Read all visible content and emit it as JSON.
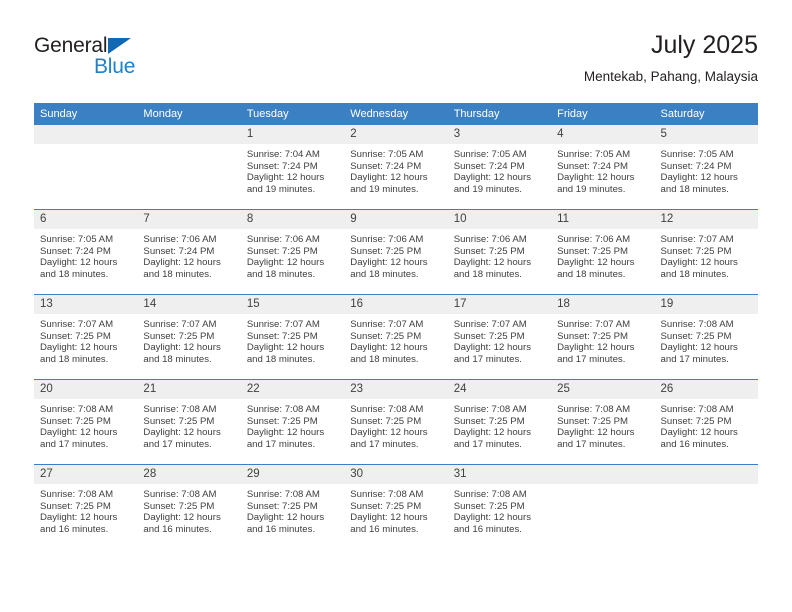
{
  "brand": {
    "name_top": "General",
    "name_bottom": "Blue",
    "color_dark": "#231f20",
    "color_blue": "#1b82d2",
    "triangle_color": "#1368b4"
  },
  "header": {
    "title": "July 2025",
    "subtitle": "Mentekab, Pahang, Malaysia"
  },
  "theme": {
    "header_bg": "#3c80c4",
    "date_band_bg": "#efefef",
    "text": "#404040"
  },
  "weekday_headers": [
    "Sunday",
    "Monday",
    "Tuesday",
    "Wednesday",
    "Thursday",
    "Friday",
    "Saturday"
  ],
  "weeks": [
    [
      {
        "date": "",
        "sunrise": "",
        "sunset": "",
        "daylight": ""
      },
      {
        "date": "",
        "sunrise": "",
        "sunset": "",
        "daylight": ""
      },
      {
        "date": "1",
        "sunrise": "Sunrise: 7:04 AM",
        "sunset": "Sunset: 7:24 PM",
        "daylight": "Daylight: 12 hours and 19 minutes."
      },
      {
        "date": "2",
        "sunrise": "Sunrise: 7:05 AM",
        "sunset": "Sunset: 7:24 PM",
        "daylight": "Daylight: 12 hours and 19 minutes."
      },
      {
        "date": "3",
        "sunrise": "Sunrise: 7:05 AM",
        "sunset": "Sunset: 7:24 PM",
        "daylight": "Daylight: 12 hours and 19 minutes."
      },
      {
        "date": "4",
        "sunrise": "Sunrise: 7:05 AM",
        "sunset": "Sunset: 7:24 PM",
        "daylight": "Daylight: 12 hours and 19 minutes."
      },
      {
        "date": "5",
        "sunrise": "Sunrise: 7:05 AM",
        "sunset": "Sunset: 7:24 PM",
        "daylight": "Daylight: 12 hours and 18 minutes."
      }
    ],
    [
      {
        "date": "6",
        "sunrise": "Sunrise: 7:05 AM",
        "sunset": "Sunset: 7:24 PM",
        "daylight": "Daylight: 12 hours and 18 minutes."
      },
      {
        "date": "7",
        "sunrise": "Sunrise: 7:06 AM",
        "sunset": "Sunset: 7:24 PM",
        "daylight": "Daylight: 12 hours and 18 minutes."
      },
      {
        "date": "8",
        "sunrise": "Sunrise: 7:06 AM",
        "sunset": "Sunset: 7:25 PM",
        "daylight": "Daylight: 12 hours and 18 minutes."
      },
      {
        "date": "9",
        "sunrise": "Sunrise: 7:06 AM",
        "sunset": "Sunset: 7:25 PM",
        "daylight": "Daylight: 12 hours and 18 minutes."
      },
      {
        "date": "10",
        "sunrise": "Sunrise: 7:06 AM",
        "sunset": "Sunset: 7:25 PM",
        "daylight": "Daylight: 12 hours and 18 minutes."
      },
      {
        "date": "11",
        "sunrise": "Sunrise: 7:06 AM",
        "sunset": "Sunset: 7:25 PM",
        "daylight": "Daylight: 12 hours and 18 minutes."
      },
      {
        "date": "12",
        "sunrise": "Sunrise: 7:07 AM",
        "sunset": "Sunset: 7:25 PM",
        "daylight": "Daylight: 12 hours and 18 minutes."
      }
    ],
    [
      {
        "date": "13",
        "sunrise": "Sunrise: 7:07 AM",
        "sunset": "Sunset: 7:25 PM",
        "daylight": "Daylight: 12 hours and 18 minutes."
      },
      {
        "date": "14",
        "sunrise": "Sunrise: 7:07 AM",
        "sunset": "Sunset: 7:25 PM",
        "daylight": "Daylight: 12 hours and 18 minutes."
      },
      {
        "date": "15",
        "sunrise": "Sunrise: 7:07 AM",
        "sunset": "Sunset: 7:25 PM",
        "daylight": "Daylight: 12 hours and 18 minutes."
      },
      {
        "date": "16",
        "sunrise": "Sunrise: 7:07 AM",
        "sunset": "Sunset: 7:25 PM",
        "daylight": "Daylight: 12 hours and 18 minutes."
      },
      {
        "date": "17",
        "sunrise": "Sunrise: 7:07 AM",
        "sunset": "Sunset: 7:25 PM",
        "daylight": "Daylight: 12 hours and 17 minutes."
      },
      {
        "date": "18",
        "sunrise": "Sunrise: 7:07 AM",
        "sunset": "Sunset: 7:25 PM",
        "daylight": "Daylight: 12 hours and 17 minutes."
      },
      {
        "date": "19",
        "sunrise": "Sunrise: 7:08 AM",
        "sunset": "Sunset: 7:25 PM",
        "daylight": "Daylight: 12 hours and 17 minutes."
      }
    ],
    [
      {
        "date": "20",
        "sunrise": "Sunrise: 7:08 AM",
        "sunset": "Sunset: 7:25 PM",
        "daylight": "Daylight: 12 hours and 17 minutes."
      },
      {
        "date": "21",
        "sunrise": "Sunrise: 7:08 AM",
        "sunset": "Sunset: 7:25 PM",
        "daylight": "Daylight: 12 hours and 17 minutes."
      },
      {
        "date": "22",
        "sunrise": "Sunrise: 7:08 AM",
        "sunset": "Sunset: 7:25 PM",
        "daylight": "Daylight: 12 hours and 17 minutes."
      },
      {
        "date": "23",
        "sunrise": "Sunrise: 7:08 AM",
        "sunset": "Sunset: 7:25 PM",
        "daylight": "Daylight: 12 hours and 17 minutes."
      },
      {
        "date": "24",
        "sunrise": "Sunrise: 7:08 AM",
        "sunset": "Sunset: 7:25 PM",
        "daylight": "Daylight: 12 hours and 17 minutes."
      },
      {
        "date": "25",
        "sunrise": "Sunrise: 7:08 AM",
        "sunset": "Sunset: 7:25 PM",
        "daylight": "Daylight: 12 hours and 17 minutes."
      },
      {
        "date": "26",
        "sunrise": "Sunrise: 7:08 AM",
        "sunset": "Sunset: 7:25 PM",
        "daylight": "Daylight: 12 hours and 16 minutes."
      }
    ],
    [
      {
        "date": "27",
        "sunrise": "Sunrise: 7:08 AM",
        "sunset": "Sunset: 7:25 PM",
        "daylight": "Daylight: 12 hours and 16 minutes."
      },
      {
        "date": "28",
        "sunrise": "Sunrise: 7:08 AM",
        "sunset": "Sunset: 7:25 PM",
        "daylight": "Daylight: 12 hours and 16 minutes."
      },
      {
        "date": "29",
        "sunrise": "Sunrise: 7:08 AM",
        "sunset": "Sunset: 7:25 PM",
        "daylight": "Daylight: 12 hours and 16 minutes."
      },
      {
        "date": "30",
        "sunrise": "Sunrise: 7:08 AM",
        "sunset": "Sunset: 7:25 PM",
        "daylight": "Daylight: 12 hours and 16 minutes."
      },
      {
        "date": "31",
        "sunrise": "Sunrise: 7:08 AM",
        "sunset": "Sunset: 7:25 PM",
        "daylight": "Daylight: 12 hours and 16 minutes."
      },
      {
        "date": "",
        "sunrise": "",
        "sunset": "",
        "daylight": ""
      },
      {
        "date": "",
        "sunrise": "",
        "sunset": "",
        "daylight": ""
      }
    ]
  ]
}
